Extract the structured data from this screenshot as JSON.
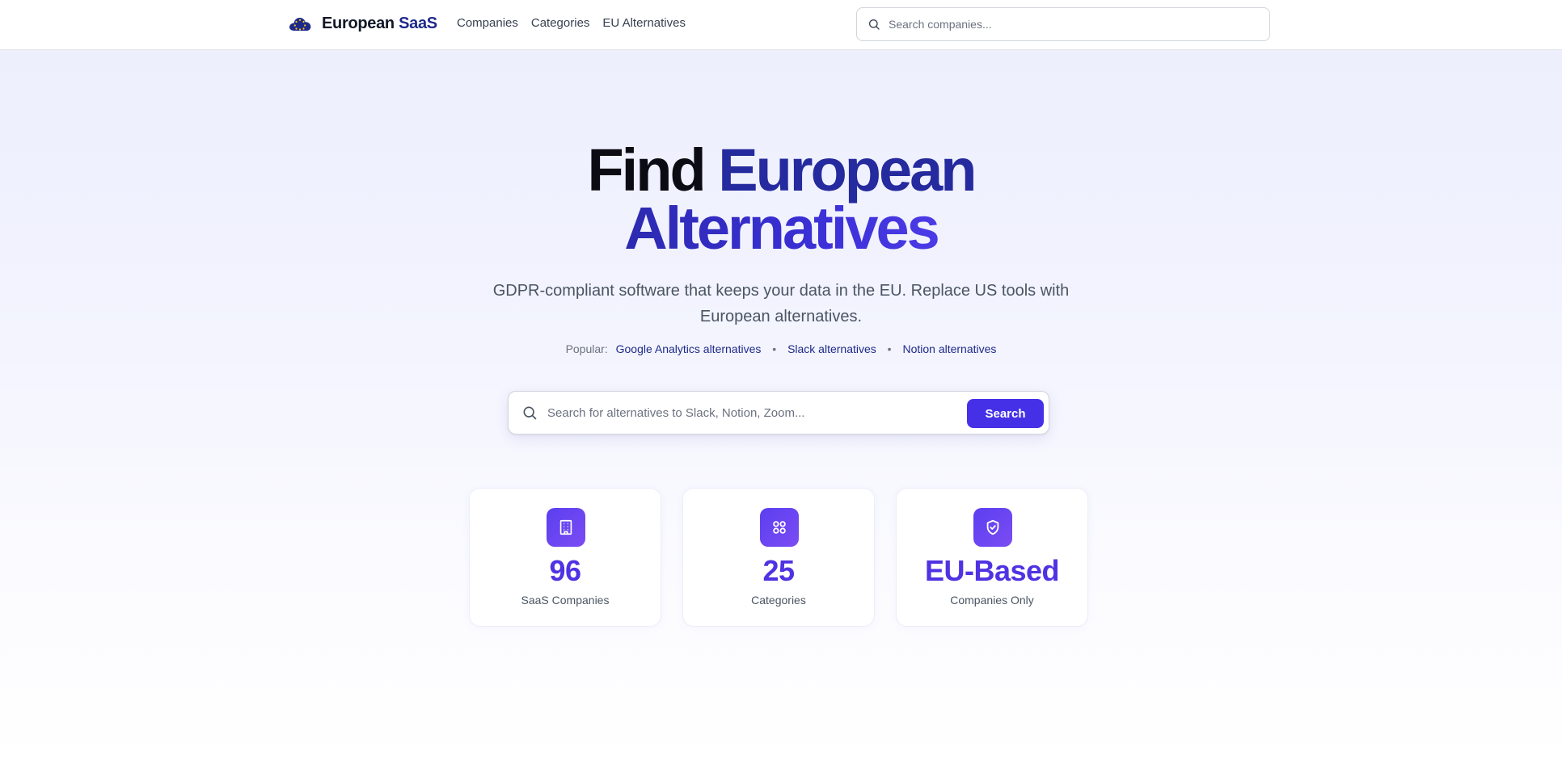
{
  "nav": {
    "brand_part1": "European",
    "brand_part2": "SaaS",
    "logo_icon": "eu-cloud-icon",
    "links": [
      "Companies",
      "Categories",
      "EU Alternatives"
    ],
    "search_placeholder": "Search companies..."
  },
  "hero": {
    "title_part1": "Find",
    "title_part2": "European",
    "title_part3": "Alternatives",
    "subtitle": "GDPR-compliant software that keeps your data in the EU. Replace US tools with European alternatives.",
    "popular_label": "Popular:",
    "popular_links": [
      "Google Analytics alternatives",
      "Slack alternatives",
      "Notion alternatives"
    ],
    "popular_separator": "•",
    "search_placeholder": "Search for alternatives to Slack, Notion, Zoom...",
    "search_button": "Search"
  },
  "stats": [
    {
      "value": "96",
      "label": "SaaS Companies",
      "icon": "building-icon"
    },
    {
      "value": "25",
      "label": "Categories",
      "icon": "grid-icon"
    },
    {
      "value": "EU-Based",
      "label": "Companies Only",
      "icon": "shield-check-icon"
    }
  ],
  "colors": {
    "primary": "#4530e8",
    "brand_accent": "#1e2a8a",
    "stat_value": "#4f33e3",
    "title_dark_blue": "#252a9e"
  }
}
